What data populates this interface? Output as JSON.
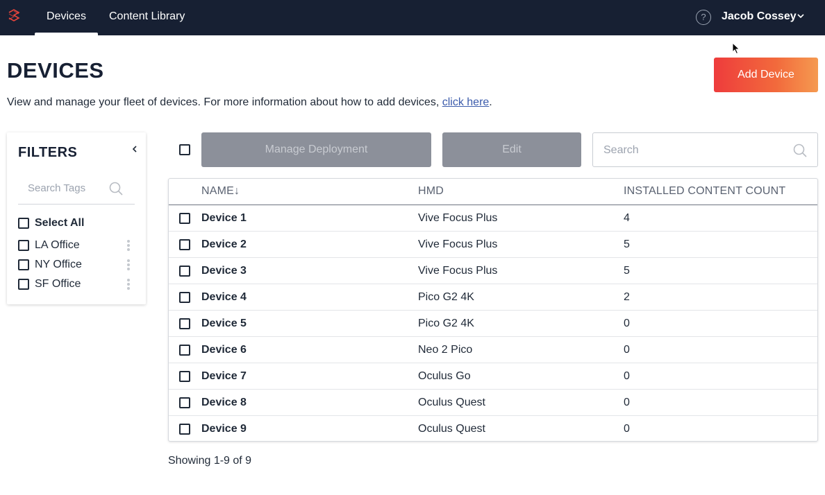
{
  "nav": {
    "tabs": [
      {
        "label": "Devices",
        "active": true
      },
      {
        "label": "Content Library",
        "active": false
      }
    ],
    "help_icon": "question-circle-icon",
    "help_glyph": "?",
    "user_name": "Jacob Cossey"
  },
  "header": {
    "title": "DEVICES",
    "description": "View and manage your fleet of devices. For more information about how to add devices, ",
    "link_text": "click here",
    "description_end": ".",
    "add_button": "Add Device"
  },
  "filters": {
    "title": "FILTERS",
    "search_placeholder": "Search Tags",
    "select_all": "Select All",
    "tags": [
      {
        "label": "LA Office"
      },
      {
        "label": "NY Office"
      },
      {
        "label": "SF Office"
      }
    ]
  },
  "toolbar": {
    "manage_label": "Manage Deployment",
    "edit_label": "Edit",
    "search_placeholder": "Search"
  },
  "table": {
    "columns": {
      "name": "NAME",
      "hmd": "HMD",
      "count": "INSTALLED CONTENT COUNT"
    },
    "sort_indicator": "↓",
    "rows": [
      {
        "name": "Device 1",
        "hmd": "Vive Focus Plus",
        "count": "4"
      },
      {
        "name": "Device 2",
        "hmd": "Vive Focus Plus",
        "count": "5"
      },
      {
        "name": "Device 3",
        "hmd": "Vive Focus Plus",
        "count": "5"
      },
      {
        "name": "Device 4",
        "hmd": "Pico G2 4K",
        "count": "2"
      },
      {
        "name": "Device 5",
        "hmd": "Pico G2 4K",
        "count": "0"
      },
      {
        "name": "Device 6",
        "hmd": "Neo 2 Pico",
        "count": "0"
      },
      {
        "name": "Device 7",
        "hmd": "Oculus Go",
        "count": "0"
      },
      {
        "name": "Device 8",
        "hmd": "Oculus Quest",
        "count": "0"
      },
      {
        "name": "Device 9",
        "hmd": "Oculus Quest",
        "count": "0"
      }
    ]
  },
  "footer": {
    "showing": "Showing 1-9 of 9"
  },
  "colors": {
    "nav_bg": "#172033",
    "accent_start": "#ee3c3c",
    "accent_end": "#f59a50",
    "disabled_button": "#8c909a",
    "link": "#3b5bab"
  }
}
